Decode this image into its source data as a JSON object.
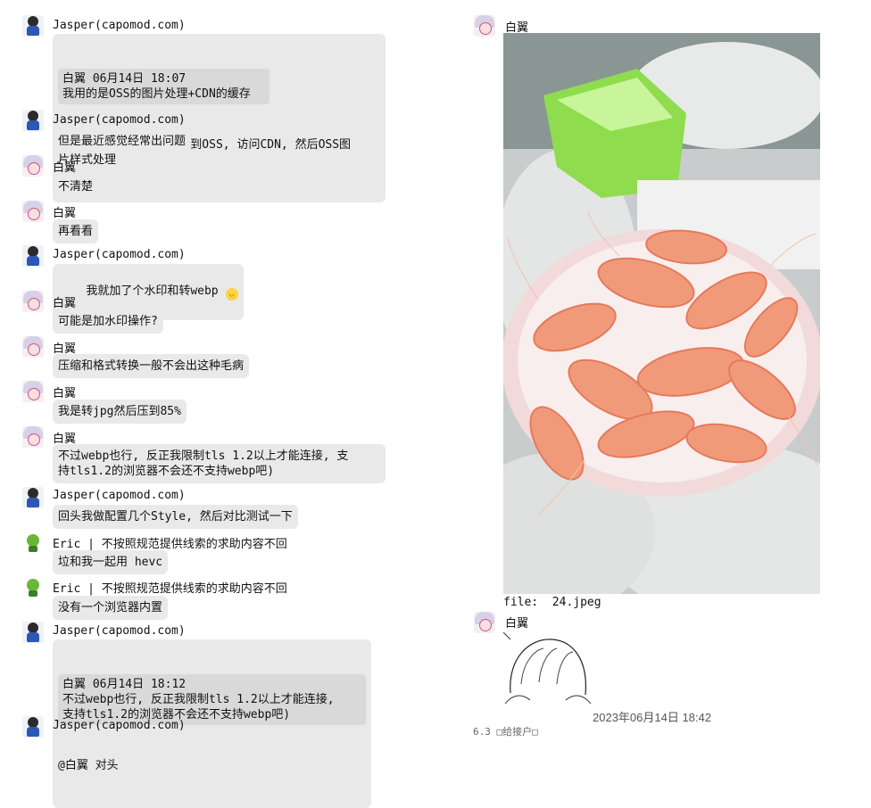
{
  "left_messages": [
    {
      "sender": "Jasper(capomod.com)",
      "avatar": "jasper",
      "quote": "白翼 06月14日 18:07\n我用的是OSS的图片处理+CDN的缓存",
      "text": "@白翼 我也是, 直接上传到OSS, 访问CDN, 然后OSS图\n片样式处理"
    },
    {
      "sender": "Jasper(capomod.com)",
      "avatar": "jasper",
      "text": "但是最近感觉经常出问题"
    },
    {
      "sender": "白翼",
      "avatar": "baiyi",
      "text": "不清楚"
    },
    {
      "sender": "白翼",
      "avatar": "baiyi",
      "text": "再看看"
    },
    {
      "sender": "Jasper(capomod.com)",
      "avatar": "jasper",
      "text": "我就加了个水印和转webp",
      "emoji": "smile-emoji"
    },
    {
      "sender": "白翼",
      "avatar": "baiyi",
      "text": "可能是加水印操作?"
    },
    {
      "sender": "白翼",
      "avatar": "baiyi",
      "text": "压缩和格式转换一般不会出这种毛病"
    },
    {
      "sender": "白翼",
      "avatar": "baiyi",
      "text": "我是转jpg然后压到85%"
    },
    {
      "sender": "白翼",
      "avatar": "baiyi",
      "text": "不过webp也行, 反正我限制tls 1.2以上才能连接, 支\n持tls1.2的浏览器不会还不支持webp吧)"
    },
    {
      "sender": "Jasper(capomod.com)",
      "avatar": "jasper",
      "text": "回头我做配置几个Style, 然后对比测试一下"
    },
    {
      "sender": "Eric | 不按照规范提供线索的求助内容不回",
      "avatar": "eric",
      "text": "垃和我一起用 hevc"
    },
    {
      "sender": "Eric | 不按照规范提供线索的求助内容不回",
      "avatar": "eric",
      "text": "没有一个浏览器内置"
    },
    {
      "sender": "Jasper(capomod.com)",
      "avatar": "jasper",
      "quote": "白翼 06月14日 18:12\n不过webp也行, 反正我限制tls 1.2以上才能连接,\n支持tls1.2的浏览器不会还不支持webp吧)",
      "text": "@白翼 对头"
    },
    {
      "sender": "Jasper(capomod.com)",
      "avatar": "jasper",
      "text": ""
    }
  ],
  "right": {
    "msg1_sender": "白翼",
    "file_label": "file:  24.jpeg",
    "msg2_sender": "白翼",
    "timestamp": "2023年06月14日 18:42",
    "cut_text": "6.3 □给接户□"
  },
  "colors": {
    "bubble": "#e9e9e9",
    "quote": "#d9d9d9"
  }
}
